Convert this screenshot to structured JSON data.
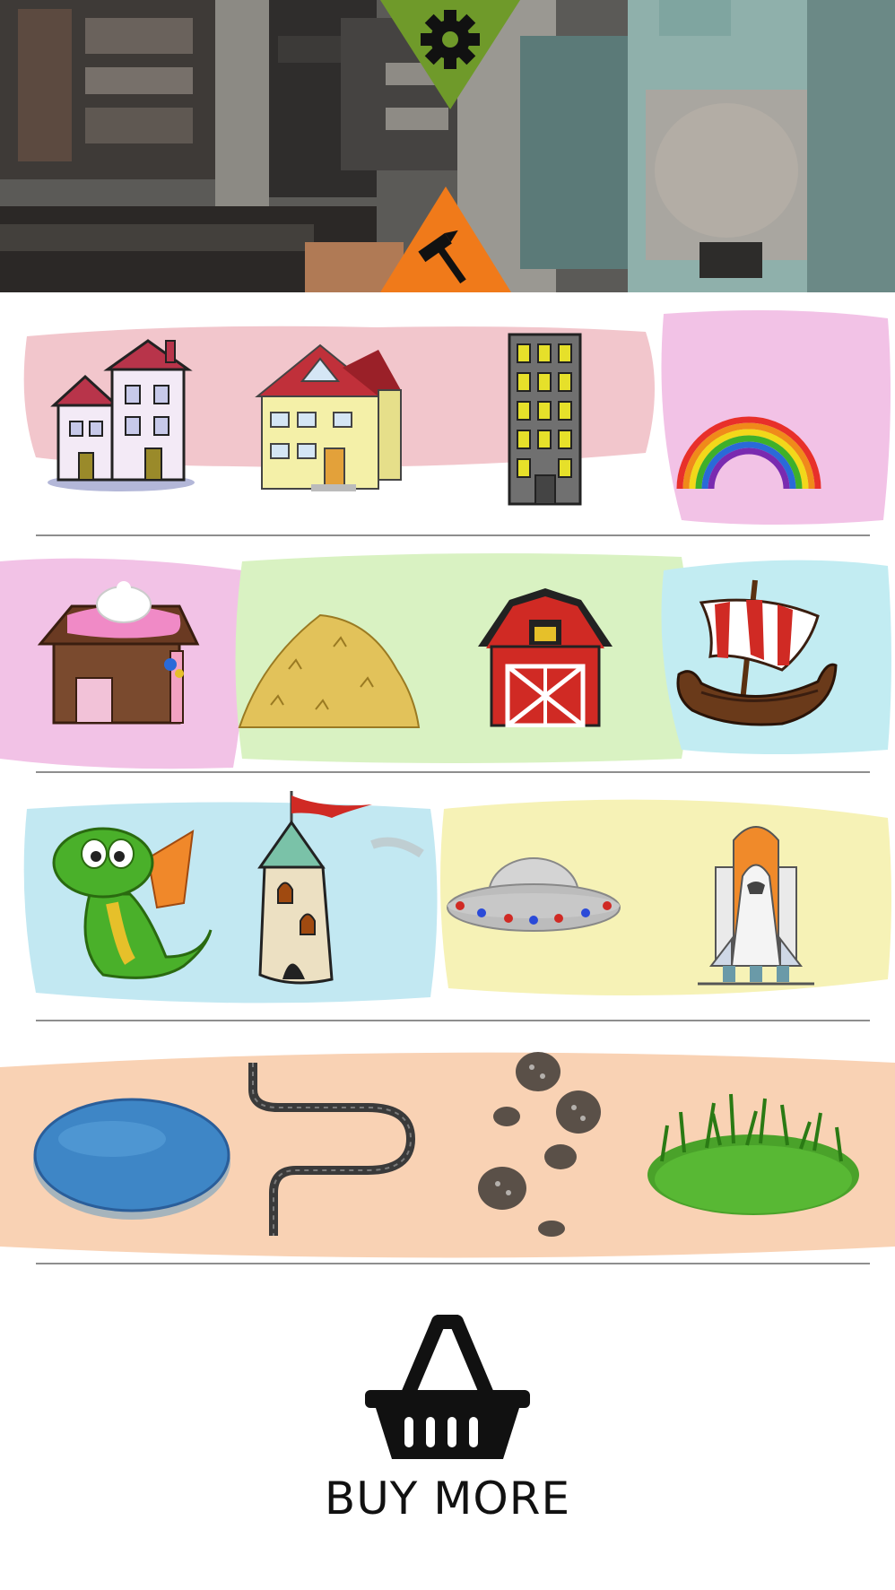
{
  "toolbar": {
    "settings_icon": "gear-icon",
    "build_icon": "hammer-icon",
    "settings_color": "#6f9a2a",
    "build_color": "#f07a1a"
  },
  "palette": {
    "rows": [
      {
        "items": [
          "houses-item",
          "villa-item",
          "skyscraper-item",
          "rainbow-item"
        ]
      },
      {
        "items": [
          "gingerbread-house-item",
          "haystack-item",
          "barn-item",
          "viking-ship-item"
        ]
      },
      {
        "items": [
          "dragon-item",
          "castle-tower-item",
          "ufo-item",
          "space-shuttle-item"
        ]
      },
      {
        "items": [
          "pond-item",
          "road-item",
          "footprints-item",
          "grass-item"
        ]
      }
    ]
  },
  "shop": {
    "icon": "basket-icon",
    "label": "BUY MORE"
  }
}
